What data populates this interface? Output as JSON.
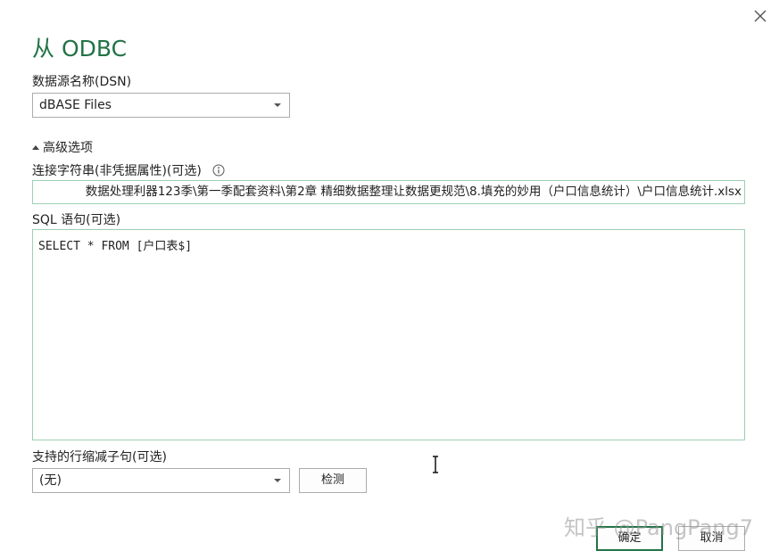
{
  "dialog": {
    "title": "从 ODBC",
    "close_icon": "close-icon"
  },
  "dsn": {
    "label": "数据源名称(DSN)",
    "value": "dBASE Files"
  },
  "advanced": {
    "label": "高级选项",
    "expanded": true
  },
  "connection_string": {
    "label": "连接字符串(非凭据属性)(可选)",
    "info_icon": "info-icon",
    "value": "数据处理利器123季\\第一季配套资料\\第2章 精细数据整理让数据更规范\\8.填充的妙用（户口信息统计）\\户口信息统计.xlsx"
  },
  "sql": {
    "label": "SQL 语句(可选)",
    "value": "SELECT * FROM [户口表$]"
  },
  "row_reduction": {
    "label": "支持的行缩减子句(可选)",
    "value": "(无)",
    "detect_label": "检测"
  },
  "buttons": {
    "ok_label": "确定",
    "cancel_label": "取消"
  },
  "watermark": "知乎 @PangPang7",
  "colors": {
    "accent": "#217346",
    "input_border": "#9fcfb3"
  }
}
